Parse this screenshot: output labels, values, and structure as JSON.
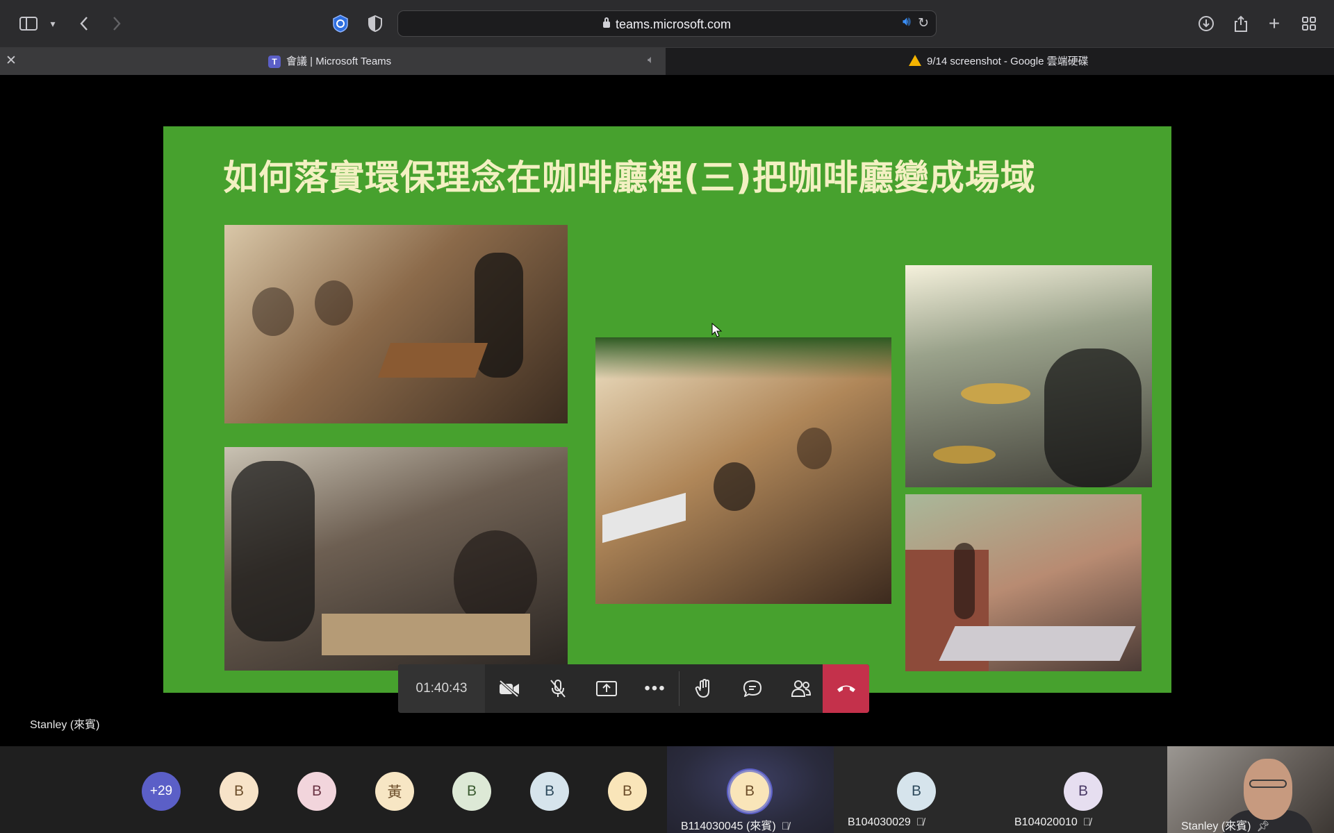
{
  "browser": {
    "url": "teams.microsoft.com",
    "tabs": [
      {
        "label": "會議 | Microsoft Teams",
        "active": true
      },
      {
        "label": "9/14 screenshot - Google 雲端硬碟",
        "active": false
      }
    ]
  },
  "slide": {
    "title": "如何落實環保理念在咖啡廳裡(三)把咖啡廳變成場域",
    "background": "#47a12e"
  },
  "call": {
    "timer": "01:40:43",
    "presenter": "Stanley (來賓)",
    "hangup_color": "#c4314b"
  },
  "participants": {
    "overflow": "+29",
    "avatars": [
      {
        "initial": "B",
        "bg": "#f7e3c8",
        "fg": "#6b4d2a"
      },
      {
        "initial": "B",
        "bg": "#f2d5dc",
        "fg": "#6b3444"
      },
      {
        "initial": "黃",
        "bg": "#f7e6c4",
        "fg": "#6b4d2a"
      },
      {
        "initial": "B",
        "bg": "#dde9d6",
        "fg": "#3a5a30"
      },
      {
        "initial": "B",
        "bg": "#d6e4ec",
        "fg": "#2e4a5c"
      },
      {
        "initial": "B",
        "bg": "#f9e5b9",
        "fg": "#6b4d2a"
      }
    ],
    "tiles": [
      {
        "name": "B114030045 (來賓)",
        "initial": "B",
        "speaking": true
      },
      {
        "name": "B104030029",
        "initial": "B",
        "speaking": false
      },
      {
        "name": "B104020010",
        "initial": "B",
        "speaking": false
      },
      {
        "name": "Stanley (來賓)",
        "video": true
      }
    ]
  }
}
